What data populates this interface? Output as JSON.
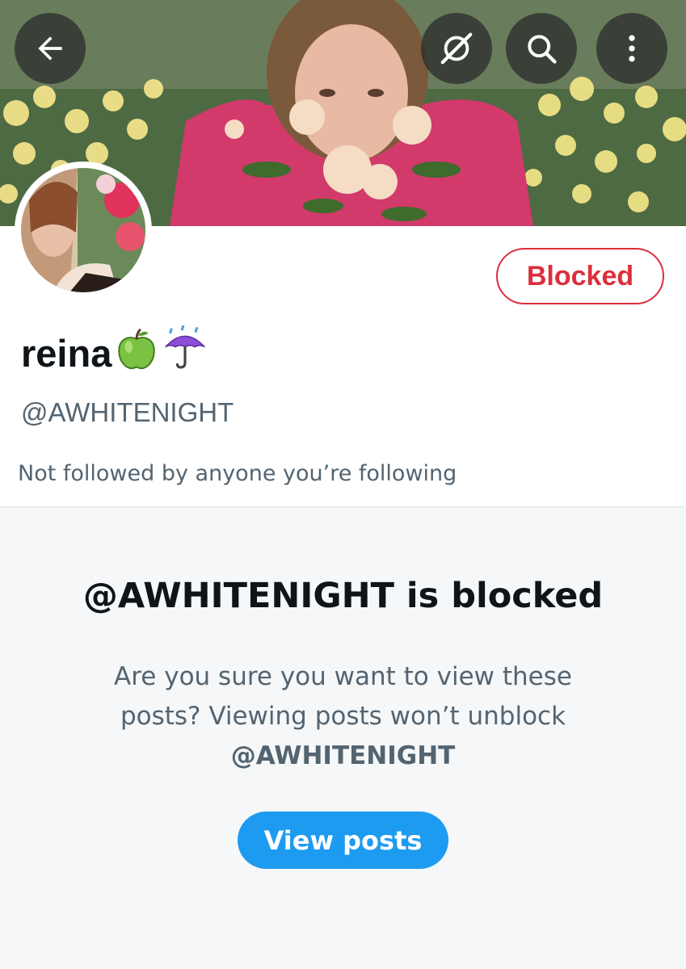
{
  "header": {
    "back_icon": "arrow-left-icon",
    "grok_icon": "grok-icon",
    "search_icon": "search-icon",
    "more_icon": "more-vertical-icon"
  },
  "profile": {
    "display_name": "reina",
    "name_emojis": [
      "🍏",
      "☔"
    ],
    "handle": "@AWHITENIGHT",
    "blocked_label": "Blocked",
    "followers_note": "Not followed by anyone you’re following"
  },
  "blocked_notice": {
    "title": "@AWHITENIGHT is blocked",
    "description": "Are you sure you want to view these posts? Viewing posts won’t unblock",
    "description_handle": "@AWHITENIGHT",
    "button_label": "View posts"
  },
  "colors": {
    "blocked_red": "#dc2f3c",
    "accent_blue": "#1d9bf0",
    "secondary_text": "#536471",
    "panel_bg": "#f5f7f8"
  }
}
